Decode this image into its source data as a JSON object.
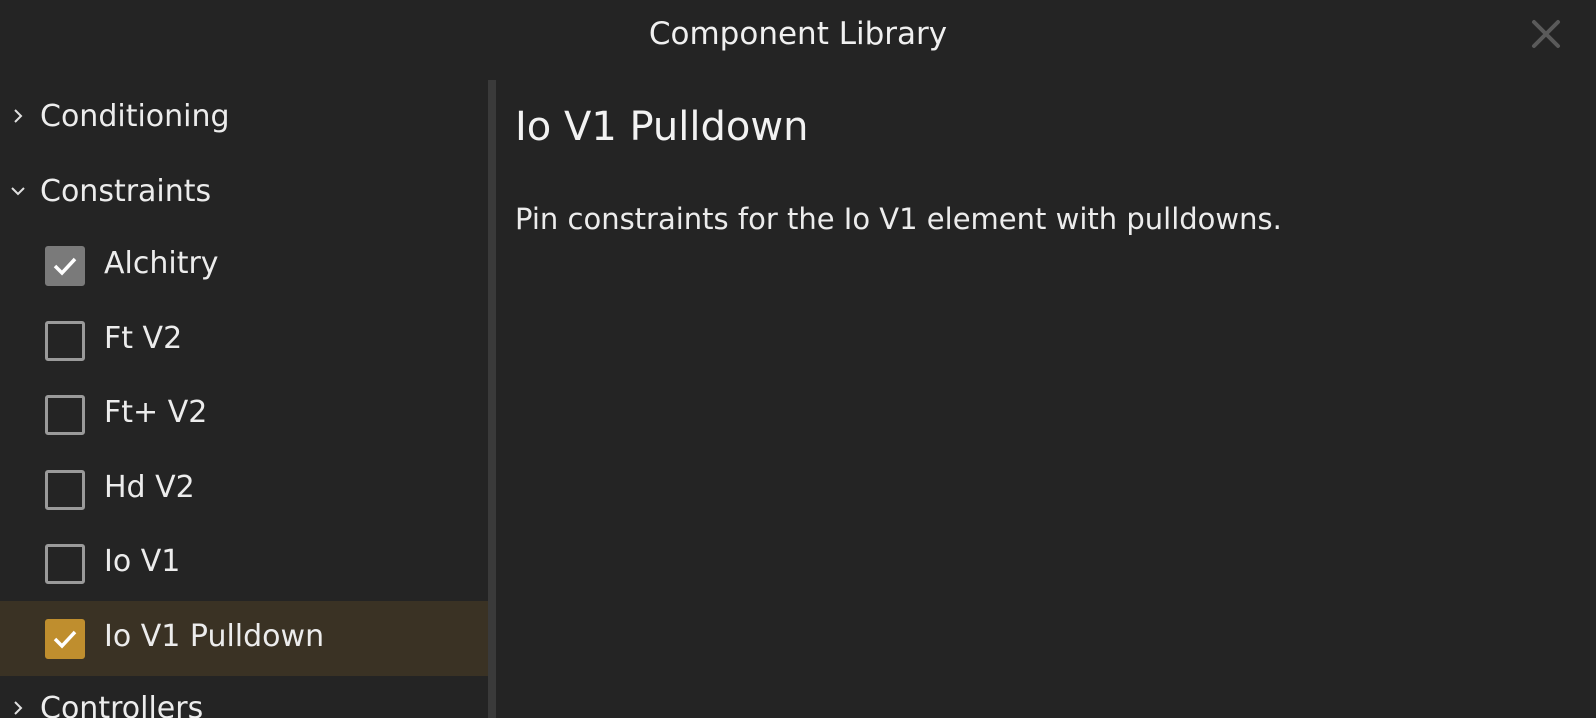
{
  "window": {
    "title": "Component Library",
    "close_icon": "close-icon"
  },
  "sidebar": {
    "categories": [
      {
        "label": "Conditioning",
        "expanded": false
      },
      {
        "label": "Constraints",
        "expanded": true
      },
      {
        "label": "Controllers",
        "expanded": false
      }
    ],
    "items": [
      {
        "label": "Alchitry",
        "checked": true
      },
      {
        "label": "Ft V2",
        "checked": false
      },
      {
        "label": "Ft+ V2",
        "checked": false
      },
      {
        "label": "Hd V2",
        "checked": false
      },
      {
        "label": "Io V1",
        "checked": false
      },
      {
        "label": "Io V1 Pulldown",
        "checked": true,
        "selected": true
      }
    ]
  },
  "detail": {
    "title": "Io V1 Pulldown",
    "description": "Pin constraints for the Io V1 element with pulldowns."
  },
  "colors": {
    "background": "#242424",
    "accent": "#bf8e2e",
    "selected_row": "#3a3224",
    "checked_grey": "#7a7a7a"
  }
}
